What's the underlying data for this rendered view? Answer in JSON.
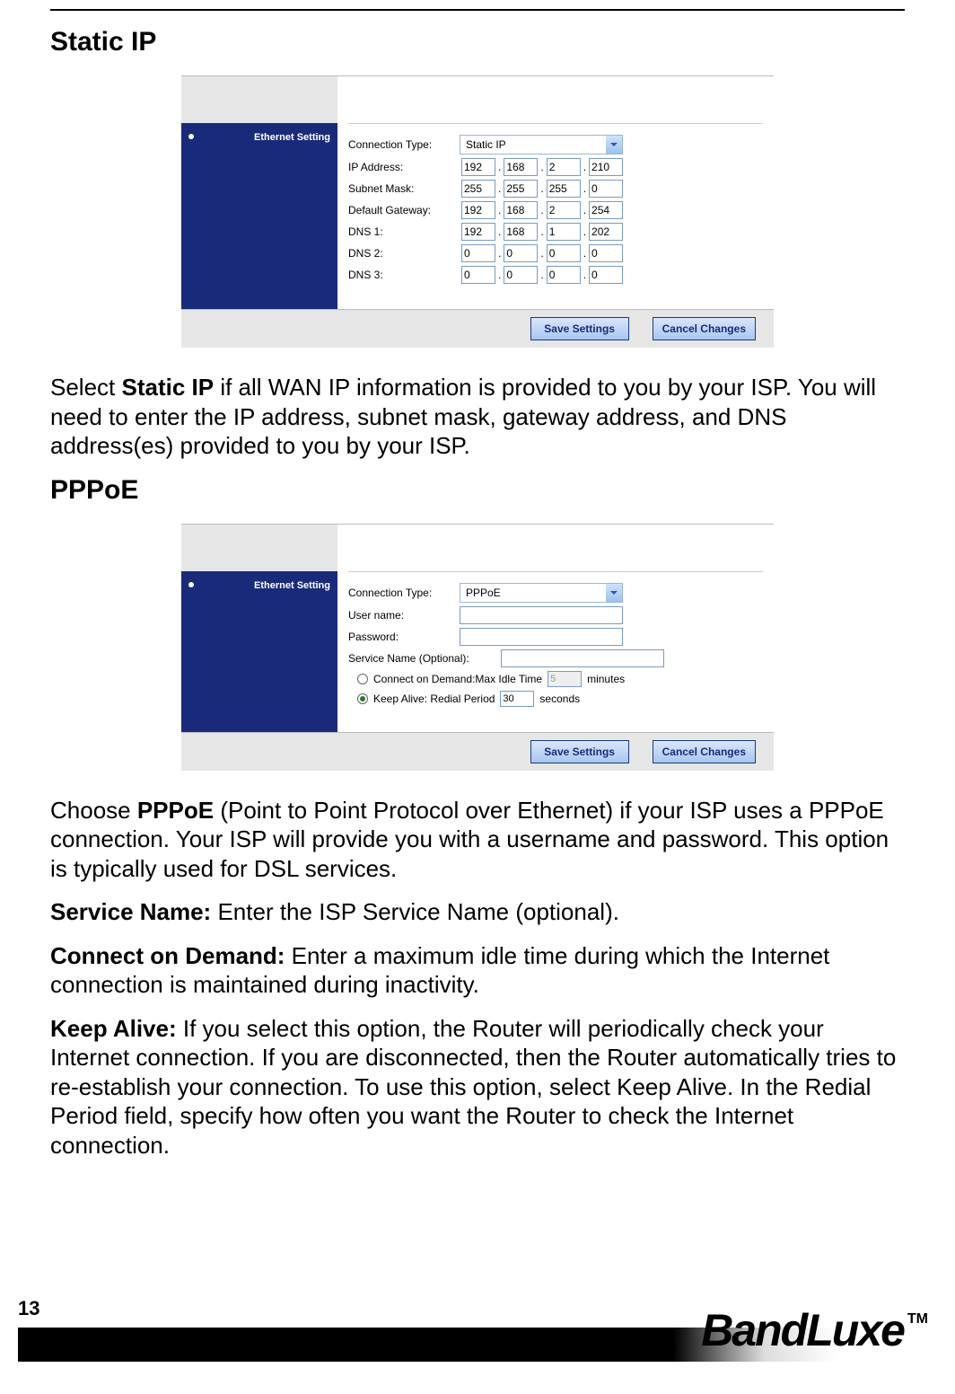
{
  "page_number": "13",
  "brand": {
    "name": "BandLuxe",
    "tm": "TM"
  },
  "section1": {
    "heading": "Static IP",
    "panel": {
      "left_label": "Ethernet Setting",
      "fields": {
        "conn_type_label": "Connection Type:",
        "conn_type_value": "Static IP",
        "ip_label": "IP Address:",
        "ip": [
          "192",
          "168",
          "2",
          "210"
        ],
        "mask_label": "Subnet Mask:",
        "mask": [
          "255",
          "255",
          "255",
          "0"
        ],
        "gw_label": "Default Gateway:",
        "gw": [
          "192",
          "168",
          "2",
          "254"
        ],
        "dns1_label": "DNS 1:",
        "dns1": [
          "192",
          "168",
          "1",
          "202"
        ],
        "dns2_label": "DNS 2:",
        "dns2": [
          "0",
          "0",
          "0",
          "0"
        ],
        "dns3_label": "DNS 3:",
        "dns3": [
          "0",
          "0",
          "0",
          "0"
        ]
      },
      "buttons": {
        "save": "Save Settings",
        "cancel": "Cancel Changes"
      }
    },
    "para1_pre": "Select ",
    "para1_bold": "Static IP",
    "para1_post": " if all WAN IP information is provided to you by your ISP. You will need to enter the IP address, subnet mask, gateway address, and DNS address(es) provided to you by your ISP."
  },
  "section2": {
    "heading": "PPPoE",
    "panel": {
      "left_label": "Ethernet Setting",
      "fields": {
        "conn_type_label": "Connection Type:",
        "conn_type_value": "PPPoE",
        "user_label": "User name:",
        "pass_label": "Password:",
        "service_label": "Service Name (Optional):",
        "cod_label": "Connect on Demand:Max Idle Time",
        "cod_value": "5",
        "cod_unit": "minutes",
        "ka_label": "Keep Alive: Redial Period",
        "ka_value": "30",
        "ka_unit": "seconds"
      },
      "buttons": {
        "save": "Save Settings",
        "cancel": "Cancel Changes"
      }
    },
    "para1_pre": "Choose ",
    "para1_bold": "PPPoE",
    "para1_post": " (Point to Point Protocol over Ethernet) if your ISP uses a PPPoE connection. Your ISP will provide you with a username and password. This option is typically used for DSL services.",
    "para2_bold": "Service Name:",
    "para2_post": " Enter the ISP Service Name (optional).",
    "para3_bold": "Connect on Demand:",
    "para3_post": " Enter a maximum idle time during which the Internet connection is maintained during inactivity.",
    "para4_bold": "Keep Alive:",
    "para4_post": " If you select this option, the Router will periodically check your Internet connection. If you are disconnected, then the Router automatically tries to re-establish your connection. To use this option, select Keep Alive. In the Redial Period field, specify how often you want the Router to check the Internet connection."
  }
}
